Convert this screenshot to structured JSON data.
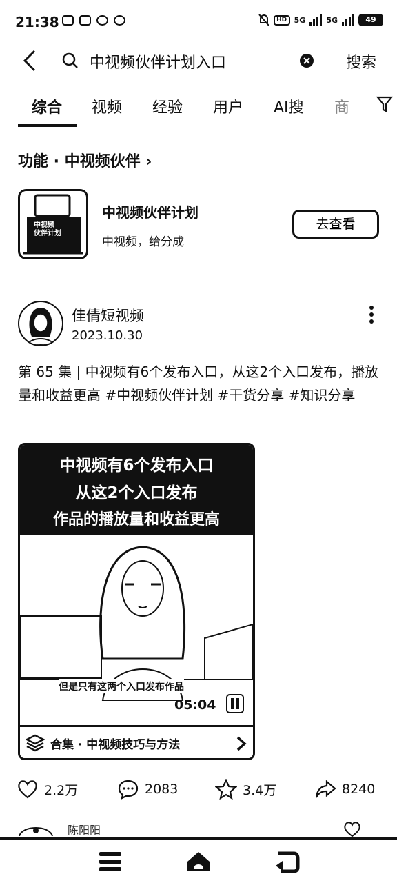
{
  "status_bar": {
    "time": "21:38",
    "left_icons": [
      "app-icon",
      "image-icon",
      "c-icon",
      "messenger-icon"
    ],
    "hd_label": "HD",
    "net_labels": [
      "5G",
      "5G"
    ],
    "battery": "49"
  },
  "search": {
    "query": "中视频伙伴计划入口",
    "button_label": "搜索"
  },
  "tabs": [
    {
      "label": "综合",
      "active": true
    },
    {
      "label": "视频"
    },
    {
      "label": "经验"
    },
    {
      "label": "用户"
    },
    {
      "label": "AI搜"
    },
    {
      "label": "商"
    }
  ],
  "feature": {
    "header": "功能 · 中视频伙伴",
    "header_arrow": "›",
    "thumb_lines": [
      "中视频",
      "伙伴计划"
    ],
    "title": "中视频伙伴计划",
    "subtitle": "中视频，给分成",
    "button_label": "去查看"
  },
  "post": {
    "author": "佳倩短视频",
    "date": "2023.10.30",
    "text": "第 65 集 | 中视频有6个发布入口，从这2个入口发布，播放量和收益更高 #中视频伙伴计划 #干货分享 #知识分享",
    "video": {
      "title_lines": [
        "中视频有6个发布入口",
        "从这2个入口发布",
        "作品的播放量和收益更高"
      ],
      "subtitle": "但是只有这两个入口发布作品",
      "duration": "05:04",
      "collection": "合集 · 中视频技巧与方法"
    },
    "stats": {
      "likes": "2.2万",
      "comments": "2083",
      "favorites": "3.4万",
      "shares": "8240"
    }
  },
  "comment_preview": {
    "user": "陈阳阳"
  }
}
